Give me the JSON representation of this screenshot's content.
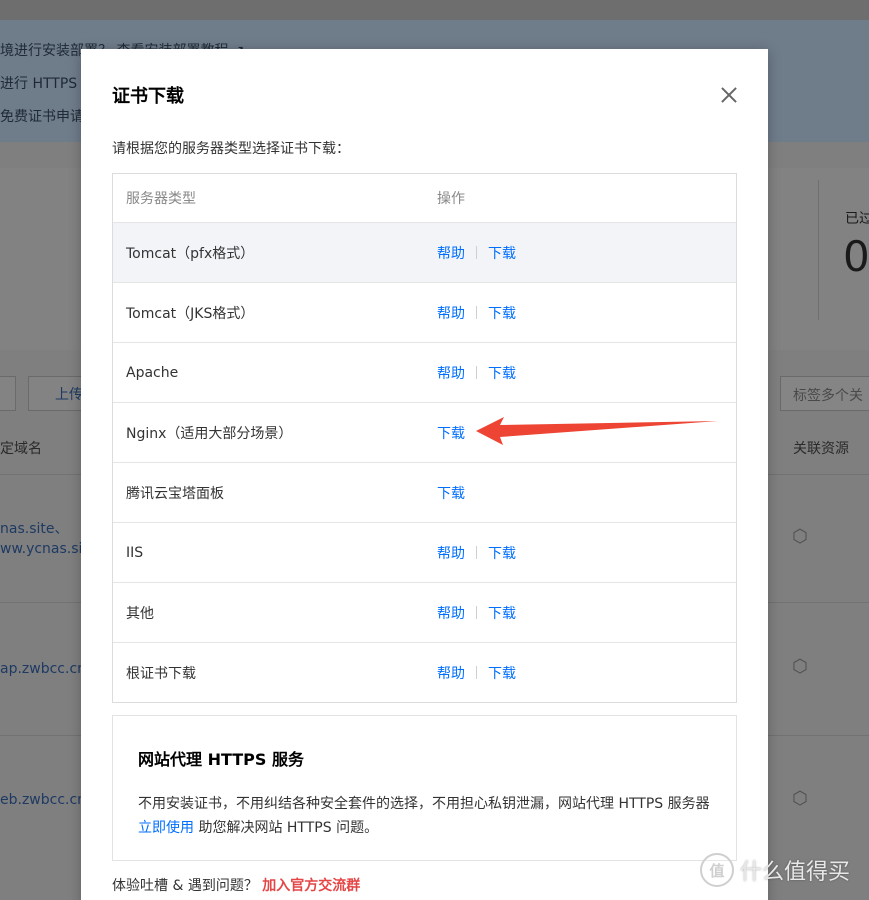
{
  "background": {
    "notice_lines": [
      "境进行安装部署？ 查看安装部署教程 ↗",
      "进行 HTTPS",
      "免费证书申请"
    ],
    "stat_label": "已过",
    "stat_value": "0",
    "toolbar": {
      "upload_label": "上传",
      "tag_search_placeholder": "标签多个关"
    },
    "table_headers": {
      "domain": "定域名",
      "resource": "关联资源"
    },
    "rows": [
      {
        "line1": "nas.site、",
        "line2": "ww.ycnas.site"
      },
      {
        "line1": "ap.zwbcc.cn"
      },
      {
        "line1": "eb.zwbcc.cn"
      }
    ]
  },
  "modal": {
    "title": "证书下载",
    "intro": "请根据您的服务器类型选择证书下载：",
    "columns": {
      "server_type": "服务器类型",
      "action": "操作"
    },
    "help_label": "帮助",
    "download_label": "下载",
    "rows": [
      {
        "name": "Tomcat（pfx格式）",
        "has_help": true
      },
      {
        "name": "Tomcat（JKS格式）",
        "has_help": true
      },
      {
        "name": "Apache",
        "has_help": true
      },
      {
        "name": "Nginx（适用大部分场景）",
        "has_help": false
      },
      {
        "name": "腾讯云宝塔面板",
        "has_help": false
      },
      {
        "name": "IIS",
        "has_help": true
      },
      {
        "name": "其他",
        "has_help": true
      },
      {
        "name": "根证书下载",
        "has_help": true
      }
    ],
    "https_promo": {
      "title": "网站代理 HTTPS 服务",
      "desc_before": "不用安装证书，不用纠结各种安全套件的选择，不用担心私钥泄漏，网站代理 HTTPS 服务器",
      "link": "立即使用",
      "desc_after": "助您解决网站 HTTPS 问题。"
    },
    "footer": {
      "text": "体验吐槽 & 遇到问题？",
      "link": "加入官方交流群"
    }
  },
  "annotation": {
    "arrow_color": "#ee4433",
    "arrow_target": "Nginx 下载"
  },
  "watermark": {
    "logo": "值",
    "text": "什么值得买"
  },
  "colors": {
    "link": "#006eff",
    "accent_red": "#e54545",
    "overlay": "#7f7f7f"
  }
}
